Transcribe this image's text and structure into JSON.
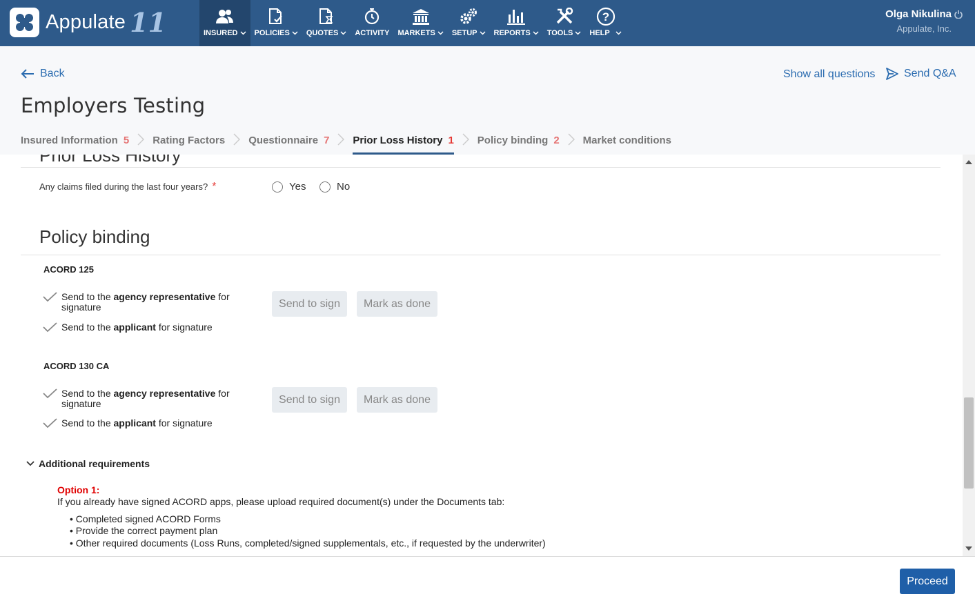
{
  "app": {
    "name": "Appulate",
    "version_mark": "11"
  },
  "nav": {
    "items": [
      {
        "label": "INSURED",
        "icon": "people-icon",
        "has_dropdown": true,
        "active": true
      },
      {
        "label": "POLICIES",
        "icon": "policy-doc-icon",
        "has_dropdown": true
      },
      {
        "label": "QUOTES",
        "icon": "quote-doc-icon",
        "has_dropdown": true
      },
      {
        "label": "ACTIVITY",
        "icon": "activity-icon",
        "has_dropdown": false
      },
      {
        "label": "MARKETS",
        "icon": "bank-icon",
        "has_dropdown": true
      },
      {
        "label": "SETUP",
        "icon": "gears-icon",
        "has_dropdown": true
      },
      {
        "label": "REPORTS",
        "icon": "bar-chart-icon",
        "has_dropdown": true
      },
      {
        "label": "TOOLS",
        "icon": "tools-icon",
        "has_dropdown": true
      },
      {
        "label": "HELP",
        "icon": "help-icon",
        "has_dropdown": true
      }
    ]
  },
  "user": {
    "name": "Olga Nikulina",
    "org": "Appulate, Inc."
  },
  "header": {
    "back": "Back",
    "title": "Employers Testing",
    "show_all": "Show all questions",
    "send_qa": "Send Q&A"
  },
  "tabs": [
    {
      "label": "Insured Information",
      "count": "5"
    },
    {
      "label": "Rating Factors",
      "count": ""
    },
    {
      "label": "Questionnaire",
      "count": "7"
    },
    {
      "label": "Prior Loss History",
      "count": "1",
      "active": true
    },
    {
      "label": "Policy binding",
      "count": "2"
    },
    {
      "label": "Market conditions",
      "count": ""
    }
  ],
  "prior_loss": {
    "title_clipped": "Prior Loss History",
    "question": "Any claims filed during the last four years?",
    "required_mark": "*",
    "yes": "Yes",
    "no": "No"
  },
  "policy_binding": {
    "title": "Policy binding",
    "forms": [
      {
        "name": "ACORD 125",
        "rep_pre": "Send to the ",
        "rep_bold": "agency representative",
        "rep_post": " for signature",
        "app_pre": "Send to the ",
        "app_bold": "applicant",
        "app_post": " for signature",
        "send_btn": "Send to sign",
        "done_btn": "Mark as done"
      },
      {
        "name": "ACORD 130 CA",
        "rep_pre": "Send to the ",
        "rep_bold": "agency representative",
        "rep_post": " for signature",
        "app_pre": "Send to the ",
        "app_bold": "applicant",
        "app_post": " for signature",
        "send_btn": "Send to sign",
        "done_btn": "Mark as done"
      }
    ],
    "additional": {
      "toggle": "Additional requirements",
      "option": "Option 1:",
      "text": "If you already have signed ACORD apps, please upload required document(s) under the Documents tab:",
      "bullets": [
        "• Completed signed ACORD Forms",
        "• Provide the correct payment plan",
        "• Other required documents (Loss Runs, completed/signed supplementals, etc., if requested by the underwriter)"
      ]
    }
  },
  "footer": {
    "proceed": "Proceed"
  },
  "colors": {
    "nav_bg": "#2e5a8a",
    "link": "#2b6cb0",
    "count": "#e57373",
    "primary_button": "#1f5fa8"
  }
}
